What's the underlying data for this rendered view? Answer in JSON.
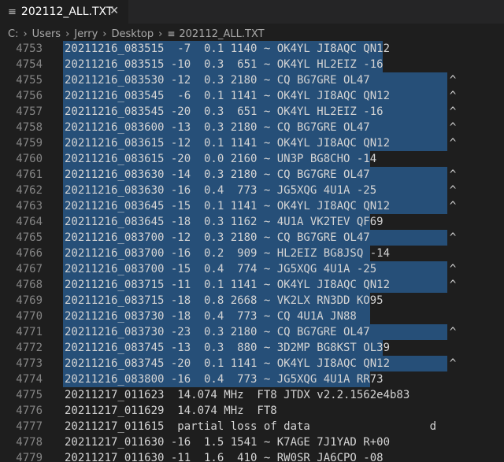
{
  "tab": {
    "title": "202112_ALL.TXT",
    "icon": "text-file-icon"
  },
  "breadcrumb": {
    "parts": [
      "C:",
      "Users",
      "Jerry",
      "Desktop"
    ],
    "file": "202112_ALL.TXT"
  },
  "lines": [
    {
      "num": "4753",
      "text": "20211216_083515  -7  0.1 1140 ~ OK4YL JI8AQC QN12",
      "sel": 406
    },
    {
      "num": "4754",
      "text": "20211216_083515 -10  0.3  651 ~ OK4YL HL2EIZ -16",
      "sel": 406
    },
    {
      "num": "4755",
      "text": "20211216_083530 -12  0.3 2180 ~ CQ BG7GRE OL47            ^",
      "sel": 488
    },
    {
      "num": "4756",
      "text": "20211216_083545  -6  0.1 1141 ~ OK4YL JI8AQC QN12         ^",
      "sel": 488
    },
    {
      "num": "4757",
      "text": "20211216_083545 -20  0.3  651 ~ OK4YL HL2EIZ -16          ^",
      "sel": 488
    },
    {
      "num": "4758",
      "text": "20211216_083600 -13  0.3 2180 ~ CQ BG7GRE OL47            ^",
      "sel": 488
    },
    {
      "num": "4759",
      "text": "20211216_083615 -12  0.1 1141 ~ OK4YL JI8AQC QN12         ^",
      "sel": 488
    },
    {
      "num": "4760",
      "text": "20211216_083615 -20  0.0 2160 ~ UN3P BG8CHO -14",
      "sel": 390
    },
    {
      "num": "4761",
      "text": "20211216_083630 -14  0.3 2180 ~ CQ BG7GRE OL47            ^",
      "sel": 488
    },
    {
      "num": "4762",
      "text": "20211216_083630 -16  0.4  773 ~ JG5XQG 4U1A -25           ^",
      "sel": 488
    },
    {
      "num": "4763",
      "text": "20211216_083645 -15  0.1 1141 ~ OK4YL JI8AQC QN12         ^",
      "sel": 488
    },
    {
      "num": "4764",
      "text": "20211216_083645 -18  0.3 1162 ~ 4U1A VK2TEV QF69",
      "sel": 390
    },
    {
      "num": "4765",
      "text": "20211216_083700 -12  0.3 2180 ~ CQ BG7GRE OL47            ^",
      "sel": 488
    },
    {
      "num": "4766",
      "text": "20211216_083700 -16  0.2  909 ~ HL2EIZ BG8JSQ -14",
      "sel": 390
    },
    {
      "num": "4767",
      "text": "20211216_083700 -15  0.4  774 ~ JG5XQG 4U1A -25           ^",
      "sel": 488
    },
    {
      "num": "4768",
      "text": "20211216_083715 -11  0.1 1141 ~ OK4YL JI8AQC QN12         ^",
      "sel": 488
    },
    {
      "num": "4769",
      "text": "20211216_083715 -18  0.8 2668 ~ VK2LX RN3DD KO95",
      "sel": 390
    },
    {
      "num": "4770",
      "text": "20211216_083730 -18  0.4  773 ~ CQ 4U1A JN88",
      "sel": 390
    },
    {
      "num": "4771",
      "text": "20211216_083730 -23  0.3 2180 ~ CQ BG7GRE OL47            ^",
      "sel": 488
    },
    {
      "num": "4772",
      "text": "20211216_083745 -13  0.3  880 ~ 3D2MP BG8KST OL39",
      "sel": 406
    },
    {
      "num": "4773",
      "text": "20211216_083745 -20  0.1 1141 ~ OK4YL JI8AQC QN12         ^",
      "sel": 488
    },
    {
      "num": "4774",
      "text": "20211216_083800 -16  0.4  773 ~ JG5XQG 4U1A RR73",
      "sel": 390
    },
    {
      "num": "4775",
      "text": "20211217_011623  14.074 MHz  FT8 JTDX v2.2.1562e4b83",
      "sel": 0
    },
    {
      "num": "4776",
      "text": "20211217_011629  14.074 MHz  FT8",
      "sel": 0
    },
    {
      "num": "4777",
      "text": "20211217_011615  partial loss of data                  d",
      "sel": 0
    },
    {
      "num": "4778",
      "text": "20211217_011630 -16  1.5 1541 ~ K7AGE 7J1YAD R+00",
      "sel": 0
    },
    {
      "num": "4779",
      "text": "20211217_011630 -11  1.6  410 ~ RW0SR JA6CPO -08",
      "sel": 0
    }
  ]
}
